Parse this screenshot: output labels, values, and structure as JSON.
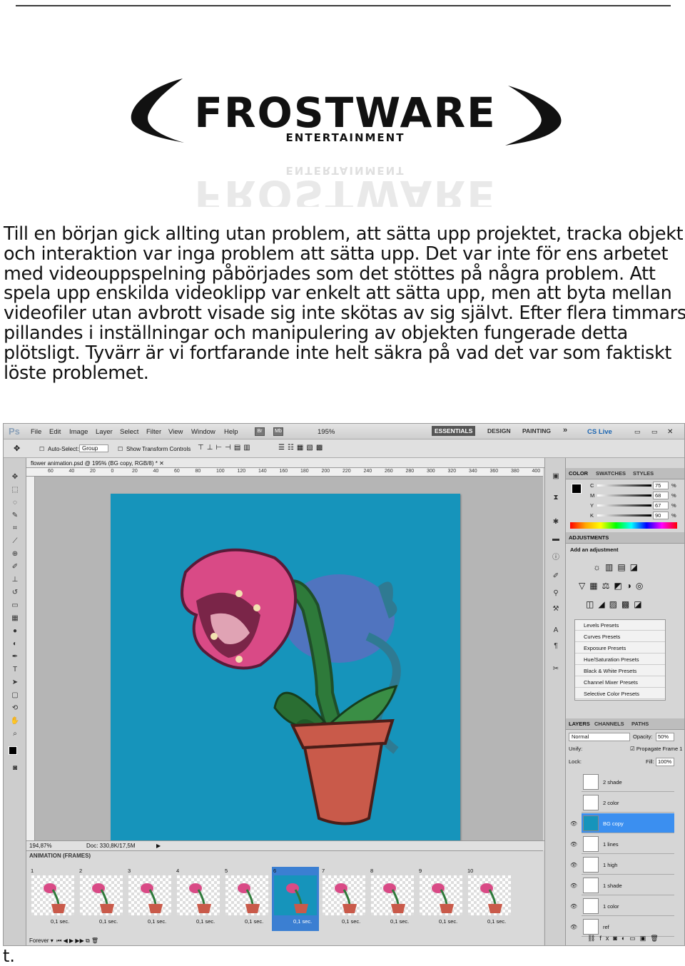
{
  "logo": {
    "main_text": "FROSTWARE",
    "sub_text": "ENTERTAINMENT"
  },
  "paragraph": [
    "Till en början gick allting utan problem, att sätta upp projektet, tracka objekt",
    "och interaktion var inga problem att sätta upp. Det var inte för ens arbetet",
    "med videouppspelning påbörjades som det stöttes på några problem. Att",
    "spela upp enskilda videoklipp var enkelt att sätta upp, men att byta mellan",
    "videofiler utan avbrott visade sig inte skötas av sig självt. Efter flera timmars",
    "pillandes i inställningar och manipulering av objekten fungerade detta",
    "plötsligt. Tyvärr är vi fortfarande inte helt säkra på vad det var som faktiskt",
    "löste problemet."
  ],
  "trailing_text": "t.",
  "ps": {
    "app_logo": "Ps",
    "menus": [
      "File",
      "Edit",
      "Image",
      "Layer",
      "Select",
      "Filter",
      "View",
      "Window",
      "Help"
    ],
    "zoom_menu": "195%",
    "workspaces": [
      "ESSENTIALS",
      "DESIGN",
      "PAINTING"
    ],
    "more": "»",
    "cs_live": "CS Live",
    "options": {
      "auto_select": "Auto-Select:",
      "group": "Group",
      "transform": "Show Transform Controls"
    },
    "doc_tab": "flower animation.psd @ 195% (BG copy, RGB/8) *",
    "ruler_ticks": [
      "60",
      "40",
      "20",
      "0",
      "20",
      "40",
      "60",
      "80",
      "100",
      "120",
      "140",
      "160",
      "180",
      "200",
      "220",
      "240",
      "260",
      "280",
      "300",
      "320",
      "340",
      "360",
      "380",
      "400"
    ],
    "status": {
      "zoom": "194,87%",
      "doc": "Doc: 330,8K/17,5M"
    },
    "animation": {
      "title": "ANIMATION (FRAMES)",
      "frames": [
        {
          "num": "1",
          "delay": "0,1 sec."
        },
        {
          "num": "2",
          "delay": "0,1 sec."
        },
        {
          "num": "3",
          "delay": "0,1 sec."
        },
        {
          "num": "4",
          "delay": "0,1 sec."
        },
        {
          "num": "5",
          "delay": "0,1 sec."
        },
        {
          "num": "6",
          "delay": "0,1 sec."
        },
        {
          "num": "7",
          "delay": "0,1 sec."
        },
        {
          "num": "8",
          "delay": "0,1 sec."
        },
        {
          "num": "9",
          "delay": "0,1 sec."
        },
        {
          "num": "10",
          "delay": "0,1 sec."
        }
      ],
      "loop": "Forever",
      "selected_index": 5
    },
    "color_panel": {
      "tabs": [
        "COLOR",
        "SWATCHES",
        "STYLES"
      ],
      "channels": [
        {
          "label": "C",
          "value": "75"
        },
        {
          "label": "M",
          "value": "68"
        },
        {
          "label": "Y",
          "value": "67"
        },
        {
          "label": "K",
          "value": "90"
        }
      ],
      "unit": "%"
    },
    "adjustments": {
      "title": "ADJUSTMENTS",
      "subtitle": "Add an adjustment",
      "presets": [
        "Levels Presets",
        "Curves Presets",
        "Exposure Presets",
        "Hue/Saturation Presets",
        "Black & White Presets",
        "Channel Mixer Presets",
        "Selective Color Presets"
      ]
    },
    "layers_panel": {
      "tabs": [
        "LAYERS",
        "CHANNELS",
        "PATHS"
      ],
      "blend_mode": "Normal",
      "opacity_label": "Opacity:",
      "opacity": "50%",
      "unify": "Unify:",
      "propagate": "Propagate Frame 1",
      "lock": "Lock:",
      "fill_label": "Fill:",
      "fill": "100%",
      "layers": [
        "2 shade",
        "2 color",
        "BG copy",
        "1 lines",
        "1 high",
        "1 shade",
        "1 color",
        "ref"
      ],
      "selected_layer": "BG copy"
    },
    "colors": {
      "canvas_bg": "#1694bb",
      "selection": "#3b8ff0",
      "pot": "#c95a4a",
      "head": "#d94a86"
    }
  }
}
